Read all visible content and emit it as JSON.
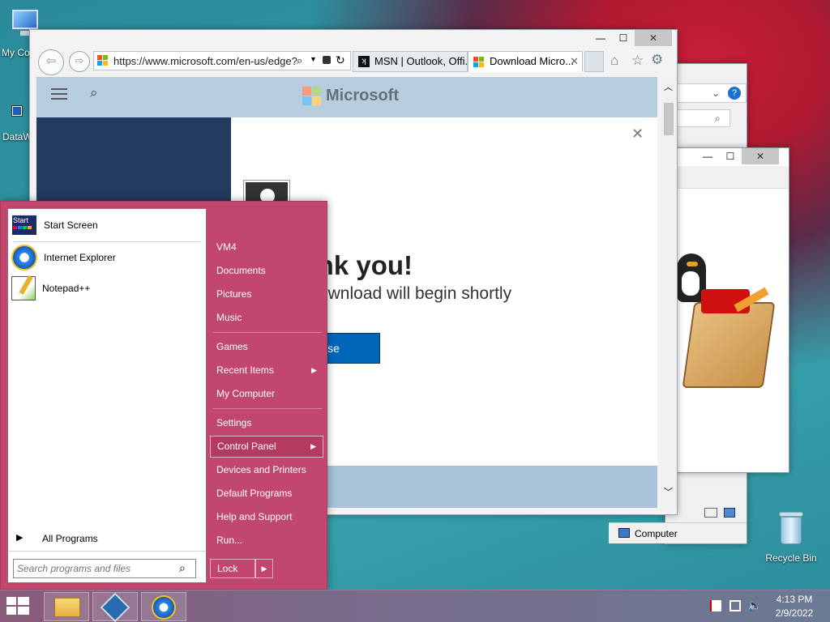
{
  "desktop": {
    "icons": [
      {
        "label": "My Co"
      },
      {
        "label": "DataW"
      },
      {
        "label": "Recycle Bin"
      }
    ]
  },
  "explorer": {
    "status": "Computer"
  },
  "ie": {
    "url": "https://www.microsoft.com/en-us/edge?",
    "tabs": [
      {
        "label": "MSN | Outlook, Offi..."
      },
      {
        "label": "Download Micro..."
      }
    ],
    "site_brand": "Microsoft",
    "dialog": {
      "title": "Thank you!",
      "subtitle": "Your download will begin shortly",
      "button": "Close"
    }
  },
  "start_menu": {
    "pinned": [
      {
        "label": "Start Screen"
      },
      {
        "label": "Internet Explorer"
      },
      {
        "label": "Notepad++"
      }
    ],
    "all_programs": "All Programs",
    "search_placeholder": "Search programs and files",
    "right_items": [
      {
        "label": "VM4"
      },
      {
        "label": "Documents"
      },
      {
        "label": "Pictures"
      },
      {
        "label": "Music"
      },
      {
        "label": "Games"
      },
      {
        "label": "Recent Items"
      },
      {
        "label": "My Computer"
      },
      {
        "label": "Settings"
      },
      {
        "label": "Control Panel"
      },
      {
        "label": "Devices and Printers"
      },
      {
        "label": "Default Programs"
      },
      {
        "label": "Help and Support"
      },
      {
        "label": "Run..."
      }
    ],
    "lock": "Lock",
    "start_tile_text": "Start"
  },
  "taskbar": {
    "time": "4:13 PM",
    "date": "2/9/2022"
  },
  "colors": {
    "start_menu_bg": "#c2476e",
    "close_button": "#0067b8",
    "site_nav": "#243a5e"
  }
}
